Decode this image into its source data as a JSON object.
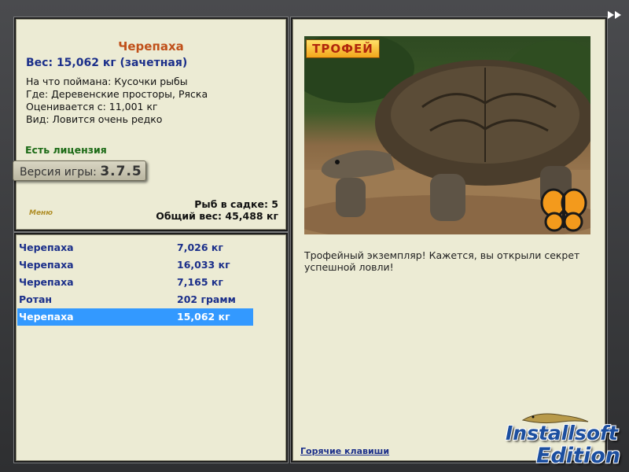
{
  "info": {
    "fish_name": "Черепаха",
    "weight_line": "Вес: 15,062 кг (зачетная)",
    "caught_on": "На что поймана: Кусочки рыбы",
    "location": "Где: Деревенские просторы, Ряска",
    "valued_from": "Оценивается с: 11,001 кг",
    "rarity": "Вид: Ловится очень редко",
    "license": "Есть лицензия",
    "version_label": "Версия игры:",
    "version_number": "3.7.5",
    "menu_label": "Меню",
    "fish_in_keepnet": "Рыб в садке: 5",
    "total_weight": "Общий вес: 45,488 кг"
  },
  "catch_list": [
    {
      "name": "Черепаха",
      "weight": "7,026 кг",
      "selected": false
    },
    {
      "name": "Черепаха",
      "weight": "16,033 кг",
      "selected": false
    },
    {
      "name": "Черепаха",
      "weight": "7,165 кг",
      "selected": false
    },
    {
      "name": "Ротан",
      "weight": "202 грамм",
      "selected": false
    },
    {
      "name": "Черепаха",
      "weight": "15,062 кг",
      "selected": true
    }
  ],
  "detail": {
    "trophy_badge": "ТРОФЕЙ",
    "trophy_text": "Трофейный экземпляр! Кажется, вы открыли секрет успешной ловли!",
    "hotkeys_link": "Горячие клавиши"
  },
  "watermark": {
    "line1": "Installsoft",
    "line2": "Edition"
  },
  "icons": {
    "fast_forward": "fast-forward-icon",
    "butterfly": "butterfly-icon"
  },
  "colors": {
    "panel_bg": "#ecebd4",
    "title_orange": "#c0501a",
    "text_blue": "#1b2f8a",
    "license_green": "#1c6b16",
    "selection_blue": "#3399ff"
  }
}
